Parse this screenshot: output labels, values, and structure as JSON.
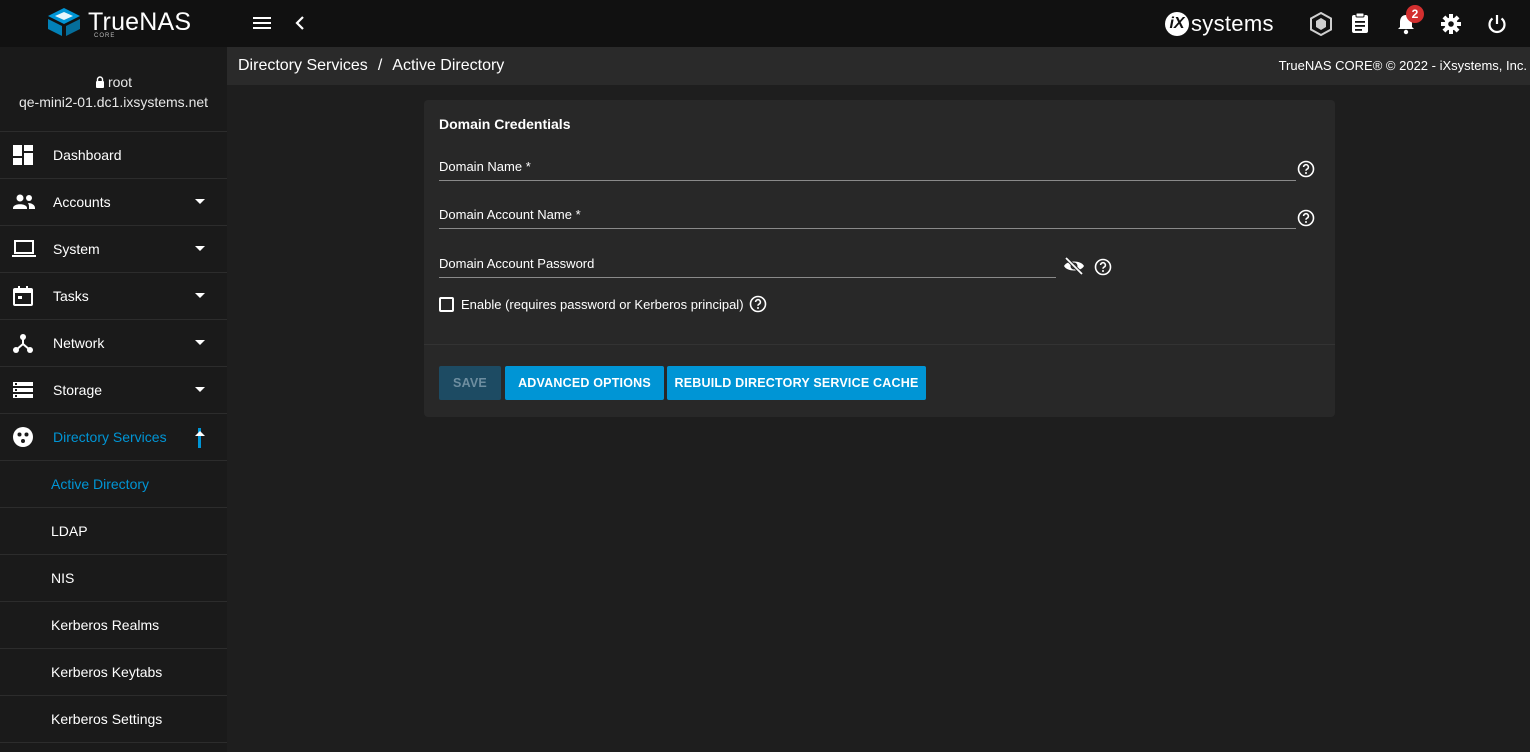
{
  "app": {
    "logo_text": "TrueNAS",
    "logo_sub": "CORE",
    "vendor_logo_mark": "iX",
    "vendor_logo_text": "systems",
    "notification_count": "2"
  },
  "user": {
    "username": "root",
    "hostname": "qe-mini2-01.dc1.ixsystems.net"
  },
  "sidebar": {
    "items": [
      {
        "label": "Dashboard",
        "icon": "dashboard-icon"
      },
      {
        "label": "Accounts",
        "icon": "people-icon"
      },
      {
        "label": "System",
        "icon": "laptop-icon"
      },
      {
        "label": "Tasks",
        "icon": "calendar-icon"
      },
      {
        "label": "Network",
        "icon": "network-icon"
      },
      {
        "label": "Storage",
        "icon": "storage-icon"
      },
      {
        "label": "Directory Services",
        "icon": "directory-icon"
      }
    ],
    "subitems": [
      {
        "label": "Active Directory"
      },
      {
        "label": "LDAP"
      },
      {
        "label": "NIS"
      },
      {
        "label": "Kerberos Realms"
      },
      {
        "label": "Kerberos Keytabs"
      },
      {
        "label": "Kerberos Settings"
      }
    ]
  },
  "header": {
    "breadcrumb_parent": "Directory Services",
    "breadcrumb_separator": "/",
    "breadcrumb_current": "Active Directory",
    "copyright": "TrueNAS CORE® © 2022 - iXsystems, Inc."
  },
  "form": {
    "title": "Domain Credentials",
    "domain_name_label": "Domain Name *",
    "domain_name_value": "",
    "account_name_label": "Domain Account Name *",
    "account_name_value": "",
    "password_label": "Domain Account Password",
    "password_value": "",
    "enable_label": "Enable (requires password or Kerberos principal)",
    "enable_checked": false
  },
  "buttons": {
    "save": "SAVE",
    "advanced": "ADVANCED OPTIONS",
    "rebuild": "REBUILD DIRECTORY SERVICE CACHE"
  },
  "colors": {
    "accent": "#0095d5",
    "badge": "#d32f2f",
    "topbar": "#111111",
    "card": "#282828"
  }
}
